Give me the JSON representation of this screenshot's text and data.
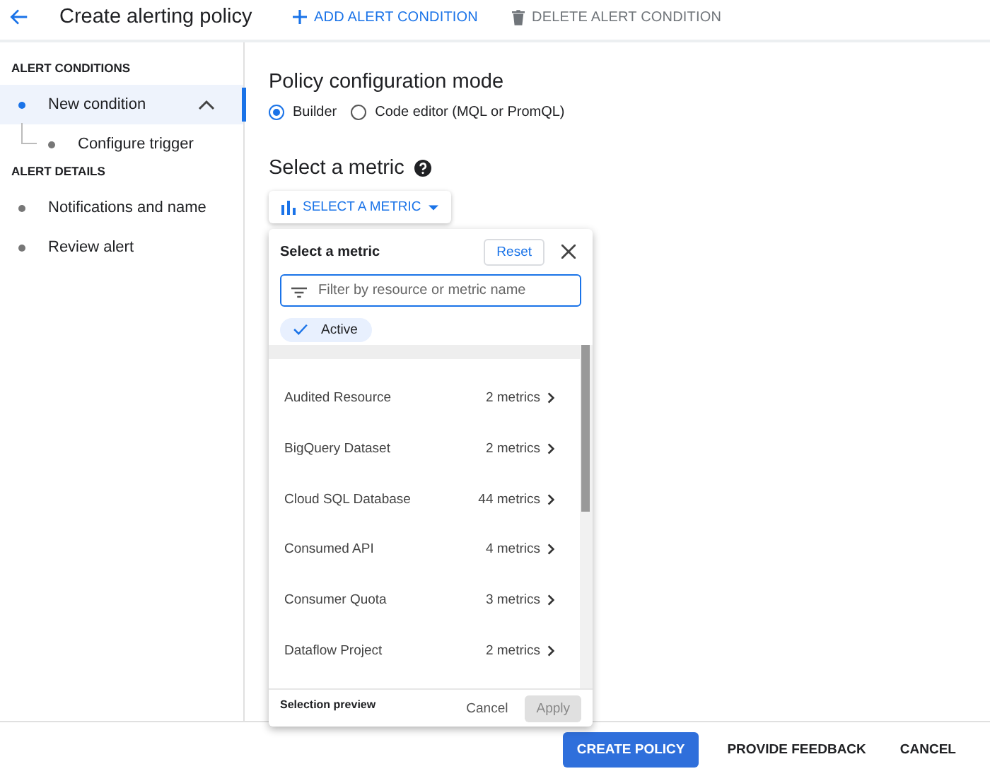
{
  "header": {
    "title": "Create alerting policy",
    "actions": [
      {
        "label": "ADD ALERT CONDITION",
        "kind": "add",
        "disabled": false
      },
      {
        "label": "DELETE ALERT CONDITION",
        "kind": "delete",
        "disabled": true
      }
    ]
  },
  "sidebar": {
    "sections": [
      {
        "heading": "ALERT CONDITIONS",
        "items": [
          {
            "label": "New condition",
            "selected": true,
            "expanded": true,
            "children": [
              {
                "label": "Configure trigger",
                "selected": false
              }
            ]
          }
        ]
      },
      {
        "heading": "ALERT DETAILS",
        "items": [
          {
            "label": "Notifications and name",
            "selected": false
          },
          {
            "label": "Review alert",
            "selected": false
          }
        ]
      }
    ]
  },
  "main": {
    "mode_title": "Policy configuration mode",
    "modes": [
      {
        "label": "Builder",
        "selected": true
      },
      {
        "label": "Code editor (MQL or PromQL)",
        "selected": false
      }
    ],
    "metric_title": "Select a metric",
    "metric_button": "SELECT A METRIC"
  },
  "metric_popup": {
    "title": "Select a metric",
    "reset": "Reset",
    "filter_placeholder": "Filter by resource or metric name",
    "chip": {
      "label": "Active",
      "checked": true
    },
    "resources": [
      {
        "name": "Audited Resource",
        "count": "2 metrics"
      },
      {
        "name": "BigQuery Dataset",
        "count": "2 metrics"
      },
      {
        "name": "Cloud SQL Database",
        "count": "44 metrics"
      },
      {
        "name": "Consumed API",
        "count": "4 metrics"
      },
      {
        "name": "Consumer Quota",
        "count": "3 metrics"
      },
      {
        "name": "Dataflow Project",
        "count": "2 metrics"
      }
    ],
    "preview_label": "Selection preview",
    "cancel": "Cancel",
    "apply": {
      "label": "Apply",
      "disabled": true
    }
  },
  "footer": {
    "buttons": [
      {
        "label": "CREATE POLICY",
        "kind": "primary"
      },
      {
        "label": "PROVIDE FEEDBACK",
        "kind": "text"
      },
      {
        "label": "CANCEL",
        "kind": "text"
      }
    ]
  }
}
